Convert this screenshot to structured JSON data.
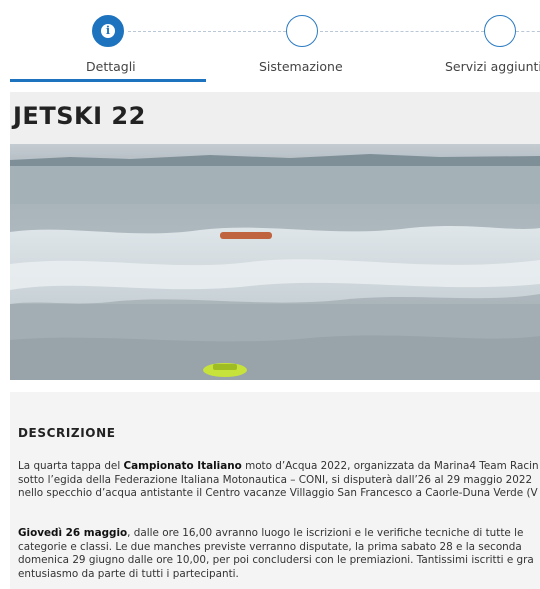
{
  "steps": [
    {
      "label": "Dettagli",
      "state": "active",
      "icon": "info-icon"
    },
    {
      "label": "Sistemazione",
      "state": "inactive"
    },
    {
      "label": "Servizi aggiunti",
      "state": "inactive"
    }
  ],
  "colors": {
    "accent": "#1e73be",
    "title_band": "#efefef",
    "description_bg": "#f4f4f4"
  },
  "event": {
    "title": "JETSKI 22",
    "image": {
      "subject": "jet ski race on the sea",
      "icon": "photo"
    }
  },
  "description": {
    "heading": "DESCRIZIONE",
    "p1": {
      "l1a": "La quarta tappa del ",
      "l1b": "Campionato Italiano",
      "l1c": " moto d’Acqua 2022, organizzata da Marina4 Team Racin",
      "l2": "sotto l’egida della Federazione Italiana Motonautica – CONI, si disputerà dall’26 al 29 maggio 2022",
      "l3": "nello specchio d’acqua antistante il Centro vacanze Villaggio San Francesco a Caorle-Duna Verde (V"
    },
    "p2": {
      "l1a": "Giovedì 26 maggio",
      "l1b": ", dalle ore 16,00 avranno luogo le iscrizioni e le verifiche tecniche di tutte le",
      "l2": "categorie e classi. Le due manches previste verranno disputate, la prima sabato 28 e la seconda",
      "l3": "domenica 29 giugno dalle ore 10,00, per poi concludersi con le premiazioni. Tantissimi iscritti e gra",
      "l4": "entusiasmo da parte di tutti i partecipanti."
    }
  }
}
